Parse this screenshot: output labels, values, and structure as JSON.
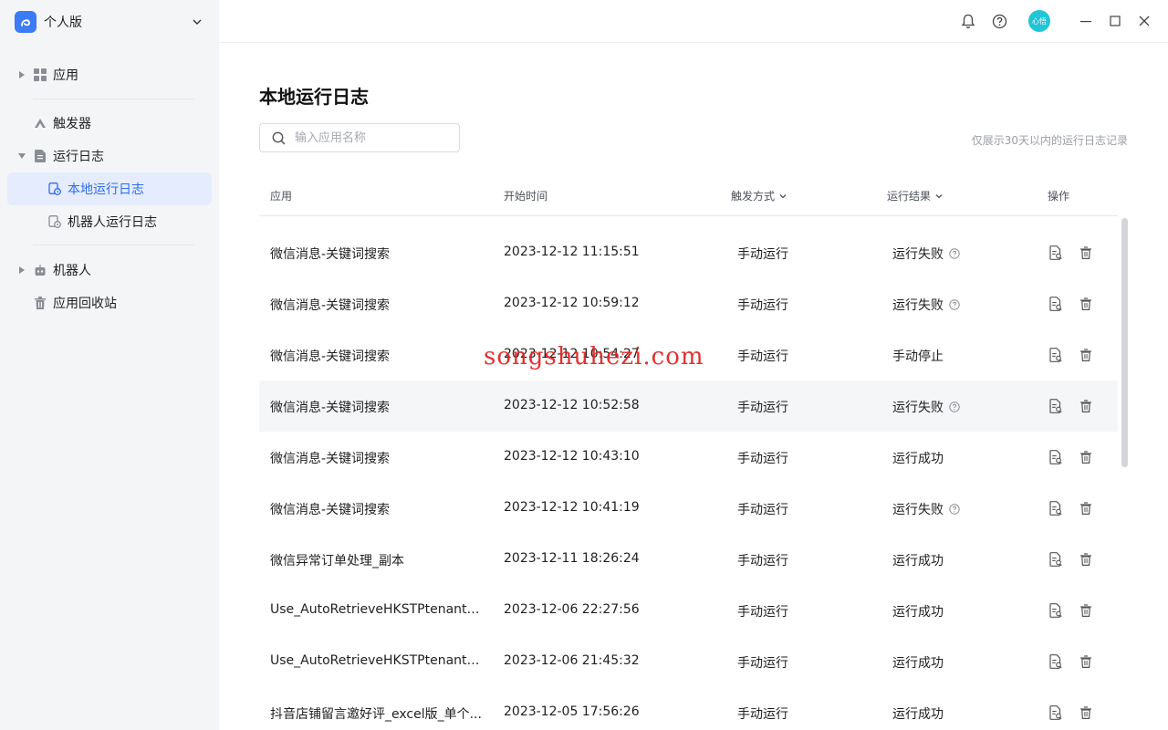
{
  "brand": {
    "name": "个人版"
  },
  "sidebar": {
    "items": [
      {
        "label": "应用"
      },
      {
        "label": "触发器"
      },
      {
        "label": "运行日志"
      },
      {
        "label": "本地运行日志"
      },
      {
        "label": "机器人运行日志"
      },
      {
        "label": "机器人"
      },
      {
        "label": "应用回收站"
      }
    ]
  },
  "topbar": {
    "avatar_text": "心悟"
  },
  "main": {
    "title": "本地运行日志",
    "search": {
      "placeholder": "输入应用名称",
      "value": ""
    },
    "hint": "仅展示30天以内的运行日志记录",
    "columns": [
      "应用",
      "开始时间",
      "触发方式",
      "运行结果",
      "操作"
    ],
    "rows": [
      {
        "app": "微信消息-关键词搜索",
        "time": "2023-12-12 11:15:51",
        "trigger": "手动运行",
        "result": "运行失败",
        "help": true
      },
      {
        "app": "微信消息-关键词搜索",
        "time": "2023-12-12 10:59:12",
        "trigger": "手动运行",
        "result": "运行失败",
        "help": true
      },
      {
        "app": "微信消息-关键词搜索",
        "time": "2023-12-12 10:54:27",
        "trigger": "手动运行",
        "result": "手动停止",
        "help": false
      },
      {
        "app": "微信消息-关键词搜索",
        "time": "2023-12-12 10:52:58",
        "trigger": "手动运行",
        "result": "运行失败",
        "help": true
      },
      {
        "app": "微信消息-关键词搜索",
        "time": "2023-12-12 10:43:10",
        "trigger": "手动运行",
        "result": "运行成功",
        "help": false
      },
      {
        "app": "微信消息-关键词搜索",
        "time": "2023-12-12 10:41:19",
        "trigger": "手动运行",
        "result": "运行失败",
        "help": true
      },
      {
        "app": "微信异常订单处理_副本",
        "time": "2023-12-11 18:26:24",
        "trigger": "手动运行",
        "result": "运行成功",
        "help": false
      },
      {
        "app": "Use_AutoRetrieveHKSTPtenants_...",
        "time": "2023-12-06 22:27:56",
        "trigger": "手动运行",
        "result": "运行成功",
        "help": false
      },
      {
        "app": "Use_AutoRetrieveHKSTPtenants_...",
        "time": "2023-12-06 21:45:32",
        "trigger": "手动运行",
        "result": "运行成功",
        "help": false
      },
      {
        "app": "抖音店铺留言邀好评_excel版_单个...",
        "time": "2023-12-05 17:56:26",
        "trigger": "手动运行",
        "result": "运行成功",
        "help": false
      }
    ]
  },
  "watermark": "songshuhezi.com",
  "colors": {
    "accent": "#2f6bef",
    "active_bg": "#e4ecfd",
    "sidebar_bg": "#f4f5f7",
    "avatar": "#21c5d6",
    "watermark": "#e02020"
  },
  "icons": [
    "app-logo-icon",
    "chevron-down-icon",
    "grid-icon",
    "trigger-icon",
    "document-icon",
    "local-log-icon",
    "robot-log-icon",
    "robot-icon",
    "trash-icon",
    "bell-icon",
    "help-icon",
    "minimize-icon",
    "maximize-icon",
    "close-icon",
    "search-icon",
    "question-icon",
    "log-detail-icon",
    "delete-icon"
  ]
}
